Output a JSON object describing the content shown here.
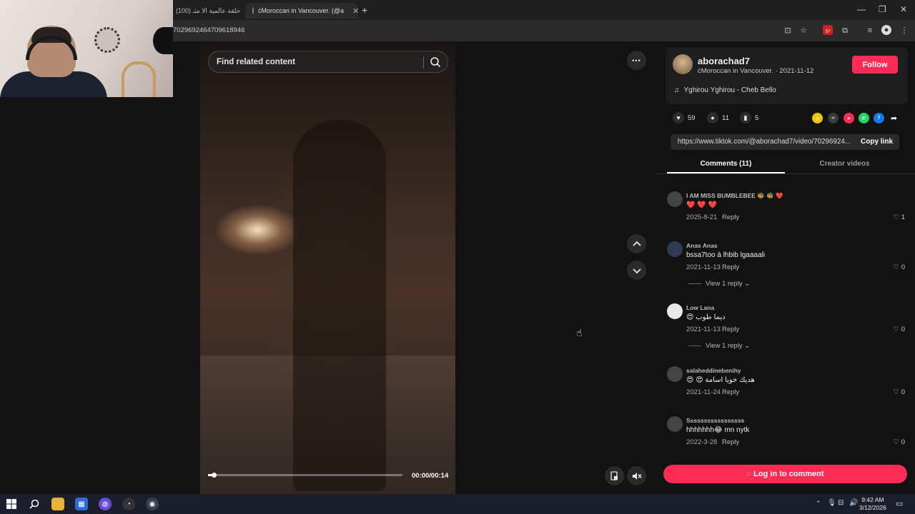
{
  "browser": {
    "tabs": [
      {
        "title": "(100) حلقة عالمية الا مثـ",
        "active": false
      },
      {
        "title": "ċMoroccan in Vancouver. (@a",
        "active": true
      }
    ],
    "url": "7029692464709618946",
    "new_tab": "+",
    "extension_badge": "57"
  },
  "video": {
    "search_placeholder": "Find related content",
    "time": "00:00/00:14",
    "progress": 0.03,
    "more_label": "•••"
  },
  "post": {
    "username": "aborachad7",
    "subline": "ċMoroccan in Vancouver. · 2021-11-12",
    "follow_label": "Follow",
    "music": "Yghirou Yghirou - Cheb Bello",
    "likes": "59",
    "comments": "11",
    "saves": "5",
    "link": "https://www.tiktok.com/@aborachad7/video/70296924...",
    "copy_label": "Copy link"
  },
  "tabs": {
    "comments_label": "Comments (11)",
    "creator_label": "Creator videos"
  },
  "comments": [
    {
      "name": "I AM MISS BUMBLEBEE 🐝 🐝 ❤️",
      "text": "❤️ ❤️ ❤️",
      "date": "2025-8-21",
      "reply": "Reply",
      "likes": "1",
      "view_replies": ""
    },
    {
      "name": "Anas Anas",
      "text": "bssa7too à lhbib lgaaaali",
      "date": "2021-11-13",
      "reply": "Reply",
      "likes": "0",
      "view_replies": "View 1 reply"
    },
    {
      "name": "Low Lana",
      "text": "😍 ديما طوب",
      "date": "2021-11-13",
      "reply": "Reply",
      "likes": "0",
      "view_replies": "View 1 reply"
    },
    {
      "name": "salaheddinebenihy",
      "text": "😍 😍 هديك خويا اسامة",
      "date": "2021-11-24",
      "reply": "Reply",
      "likes": "0",
      "view_replies": ""
    },
    {
      "name": "Sssssssssssssssss",
      "text": "hhhhhhh😂 mn nytk",
      "date": "2022-3-28",
      "reply": "Reply",
      "likes": "0",
      "view_replies": ""
    }
  ],
  "login_label": "Log in to comment",
  "taskbar": {
    "time": "9:42 AM",
    "date": "3/12/2026"
  },
  "colors": {
    "accent": "#fe2c55",
    "background": "#121212"
  }
}
